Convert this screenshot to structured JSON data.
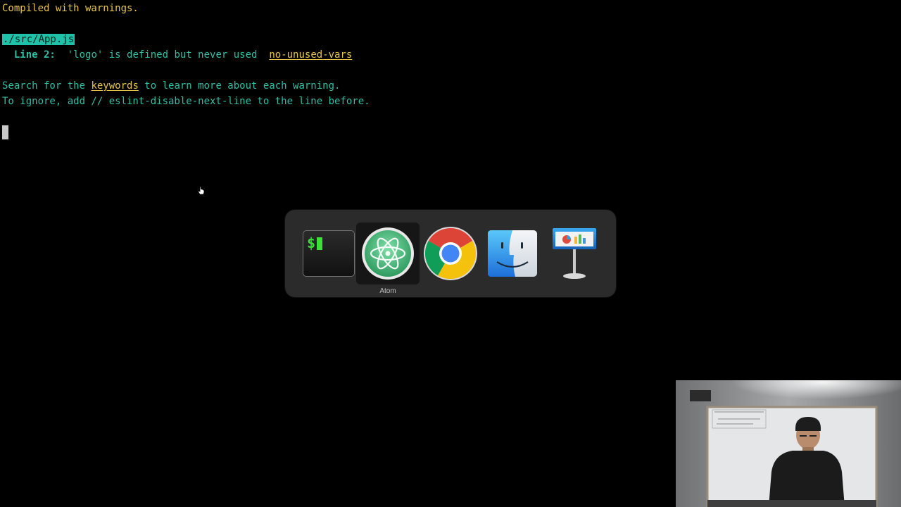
{
  "terminal": {
    "line1": "Compiled with warnings.",
    "file": "./src/App.js",
    "warning": {
      "line_label": "Line 2:",
      "message": "'logo' is defined but never used",
      "rule": "no-unused-vars"
    },
    "hint1": {
      "before": "Search for the ",
      "keyword": "keywords",
      "after": " to learn more about each warning."
    },
    "hint2": "To ignore, add // eslint-disable-next-line to the line before."
  },
  "app_switcher": {
    "apps": [
      {
        "name": "Terminal",
        "icon": "terminal-icon",
        "label": ""
      },
      {
        "name": "Atom",
        "icon": "atom-icon",
        "label": "Atom",
        "selected": true
      },
      {
        "name": "Chrome",
        "icon": "chrome-icon",
        "label": ""
      },
      {
        "name": "Finder",
        "icon": "finder-icon",
        "label": ""
      },
      {
        "name": "Keynote",
        "icon": "keynote-icon",
        "label": ""
      }
    ]
  },
  "colors": {
    "terminal_text": "#2fbfa6",
    "terminal_warning": "#e8c547",
    "file_highlight": "#1fc2a9",
    "switcher_bg": "#2d2d2d"
  }
}
